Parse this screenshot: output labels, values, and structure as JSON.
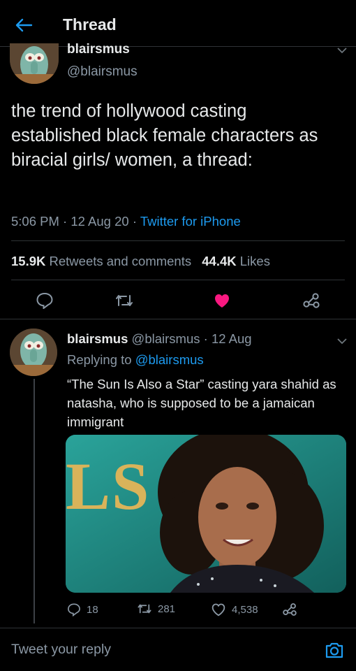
{
  "header": {
    "title": "Thread"
  },
  "main_tweet": {
    "display_name_partial": "blairsmus",
    "handle": "@blairsmus",
    "text": "the trend of hollywood casting established black female characters as biracial girls/ women, a thread:",
    "time": "5:06 PM",
    "date": "12 Aug 20",
    "client": "Twitter for iPhone",
    "retweets_count": "15.9K",
    "retweets_label": "Retweets and comments",
    "likes_count": "44.4K",
    "likes_label": "Likes",
    "liked": true
  },
  "reply_tweet": {
    "display_name": "blairsmus",
    "handle": "@blairsmus",
    "date": "12 Aug",
    "replying_label": "Replying to",
    "replying_to": "@blairsmus",
    "text": "“The Sun Is Also a Star” casting yara shahid as natasha, who is supposed to be a jamaican immigrant",
    "image_backdrop_text": "LS",
    "reply_count": "18",
    "retweet_count": "281",
    "like_count": "4,538"
  },
  "composer": {
    "placeholder": "Tweet your reply"
  },
  "colors": {
    "accent": "#1d9bf0",
    "like": "#f91880",
    "background": "#000000"
  }
}
